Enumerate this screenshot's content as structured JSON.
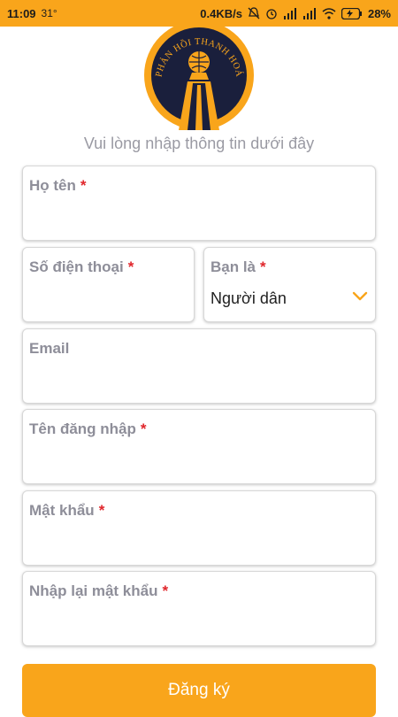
{
  "status_bar": {
    "time": "11:09",
    "temp": "31°",
    "net_speed": "0.4KB/s",
    "battery": "28%"
  },
  "logo": {
    "text": "PHẢN HỒI THANH HOÁ",
    "colors": {
      "ring": "#f9a51b",
      "inner": "#1a1f3c"
    }
  },
  "form": {
    "subtitle": "Vui lòng nhập thông tin dưới đây",
    "fields": {
      "fullname": {
        "label": "Họ tên",
        "required_mark": "*",
        "value": ""
      },
      "phone": {
        "label": "Số điện thoại",
        "required_mark": "*",
        "value": ""
      },
      "role": {
        "label": "Bạn là",
        "required_mark": "*",
        "value": "Người dân",
        "icon": "chevron-down-icon"
      },
      "email": {
        "label": "Email",
        "value": ""
      },
      "username": {
        "label": "Tên đăng nhập",
        "required_mark": "*",
        "value": ""
      },
      "password": {
        "label": "Mật khẩu",
        "required_mark": "*",
        "value": ""
      },
      "password_confirm": {
        "label": "Nhập lại mật khẩu",
        "required_mark": "*",
        "value": ""
      }
    },
    "submit_label": "Đăng ký"
  },
  "colors": {
    "accent": "#f9a51b",
    "required": "#e0262b",
    "label": "#8e8e99",
    "button_text": "#ffffff"
  }
}
